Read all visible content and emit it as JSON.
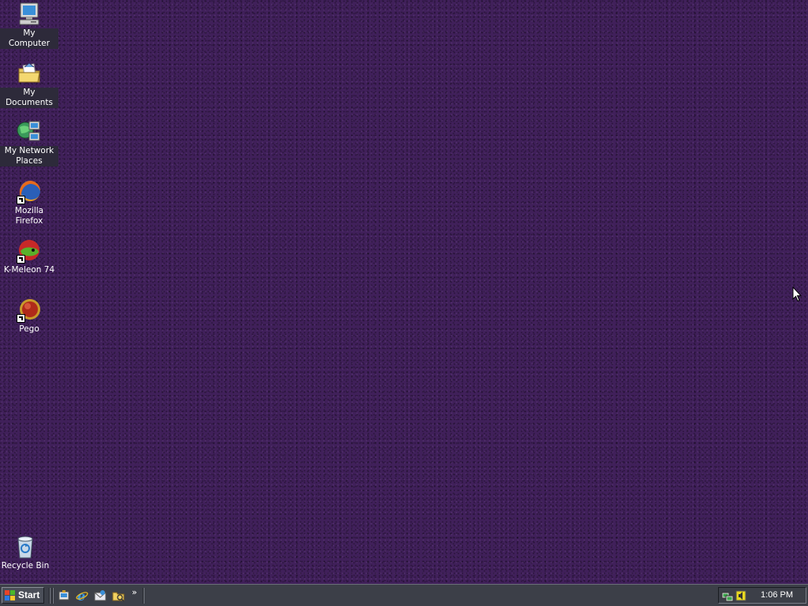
{
  "desktop": {
    "background_color": "#40205a",
    "icons": [
      {
        "label": "My Computer",
        "icon": "computer-icon"
      },
      {
        "label": "My Documents",
        "icon": "folder-documents-icon"
      },
      {
        "label": "My Network Places",
        "icon": "network-places-icon"
      },
      {
        "label": "Mozilla Firefox",
        "icon": "firefox-icon",
        "shortcut": true
      },
      {
        "label": "K-Meleon 74",
        "icon": "k-meleon-icon",
        "shortcut": true
      },
      {
        "label": "Pego",
        "icon": "pego-icon",
        "shortcut": true
      },
      {
        "label": "Recycle Bin",
        "icon": "recycle-bin-icon"
      }
    ]
  },
  "taskbar": {
    "start_label": "Start",
    "quick_launch": [
      {
        "icon": "show-desktop-icon"
      },
      {
        "icon": "internet-explorer-icon"
      },
      {
        "icon": "outlook-express-icon"
      },
      {
        "icon": "explorer-folder-icon"
      }
    ],
    "quick_launch_more": "»",
    "tray_icons": [
      {
        "icon": "network-tray-icon"
      },
      {
        "icon": "volume-tray-icon"
      }
    ],
    "clock": "1:06 PM"
  }
}
